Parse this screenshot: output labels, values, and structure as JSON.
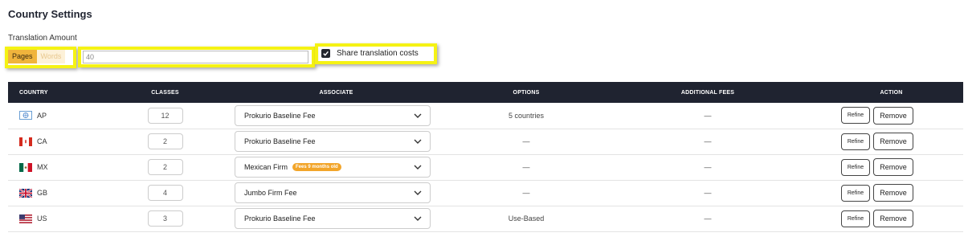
{
  "page": {
    "title": "Country Settings"
  },
  "translation": {
    "label": "Translation Amount",
    "mode_pages": "Pages",
    "mode_words": "Words",
    "amount_value": "40",
    "share_label": "Share translation costs",
    "share_checked": true
  },
  "table": {
    "headers": {
      "country": "COUNTRY",
      "classes": "CLASSES",
      "associate": "ASSOCIATE",
      "options": "OPTIONS",
      "fees": "ADDITIONAL FEES",
      "action": "ACTION"
    },
    "rows": [
      {
        "code": "AP",
        "flag": "ap-flag-icon",
        "classes": "12",
        "associate": "Prokurio Baseline Fee",
        "badge": "",
        "options": "5 countries",
        "fees": "—"
      },
      {
        "code": "CA",
        "flag": "canada-flag-icon",
        "classes": "2",
        "associate": "Prokurio Baseline Fee",
        "badge": "",
        "options": "—",
        "fees": "—"
      },
      {
        "code": "MX",
        "flag": "mexico-flag-icon",
        "classes": "2",
        "associate": "Mexican Firm",
        "badge": "Fees 9 months old",
        "options": "—",
        "fees": "—"
      },
      {
        "code": "GB",
        "flag": "uk-flag-icon",
        "classes": "4",
        "associate": "Jumbo Firm Fee",
        "badge": "",
        "options": "—",
        "fees": "—"
      },
      {
        "code": "US",
        "flag": "us-flag-icon",
        "classes": "3",
        "associate": "Prokurio Baseline Fee",
        "badge": "",
        "options": "Use-Based",
        "fees": "—"
      }
    ],
    "refine_label": "Refine",
    "remove_label": "Remove"
  },
  "colors": {
    "header_bg": "#1f2330",
    "pages_active": "#f0b43c",
    "badge": "#f2a52a",
    "highlight": "#f5f214"
  }
}
